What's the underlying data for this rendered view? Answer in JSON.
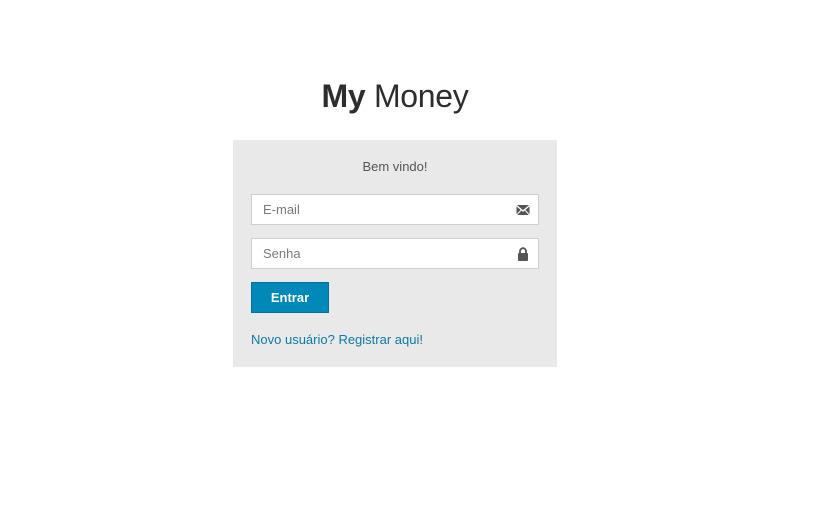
{
  "logo": {
    "bold": "My",
    "light": "Money"
  },
  "login": {
    "welcome": "Bem vindo!",
    "email": {
      "placeholder": "E-mail",
      "value": "",
      "icon": "envelope-icon"
    },
    "password": {
      "placeholder": "Senha",
      "value": "",
      "icon": "lock-icon"
    },
    "submit_label": "Entrar",
    "register_link": "Novo usuário? Registrar aqui!"
  },
  "colors": {
    "accent": "#0088b8",
    "link": "#0a7aa8",
    "panel_bg": "#e9e9e9",
    "icon": "#555555"
  }
}
